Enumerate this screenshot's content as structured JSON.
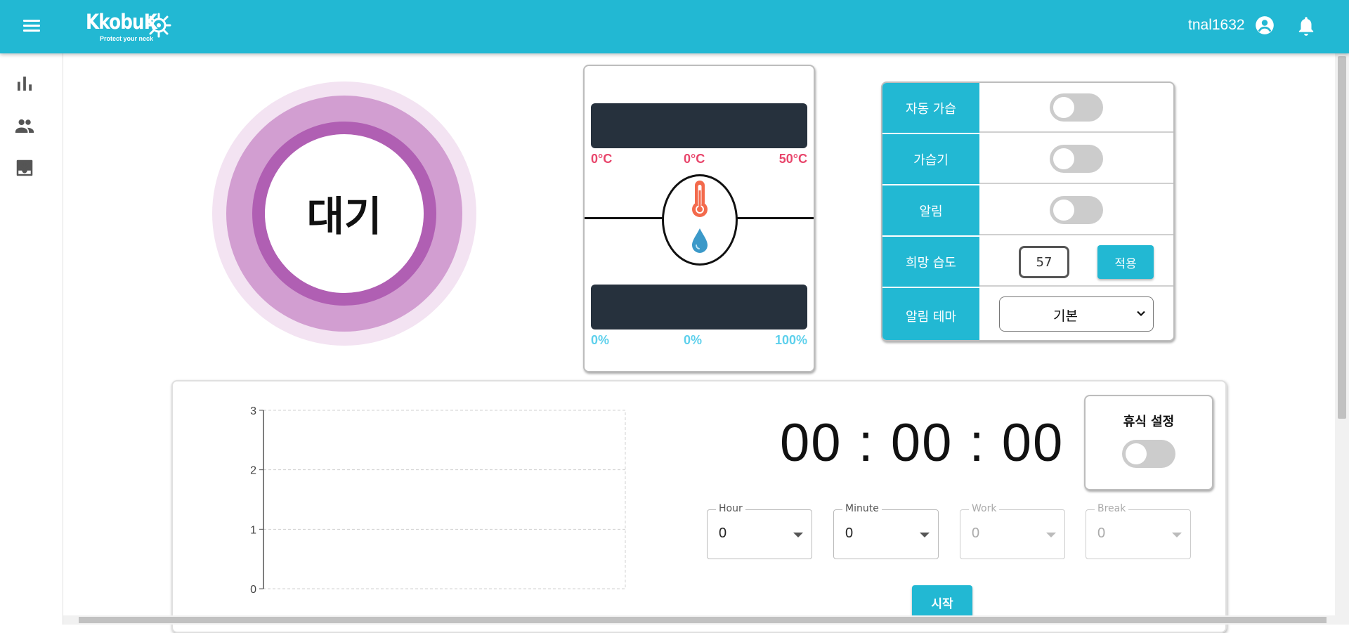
{
  "header": {
    "logo_text": "KkobuK",
    "logo_tagline": "Protect your neck",
    "username": "tnal1632",
    "icons": [
      "menu-icon",
      "account-circle-icon",
      "bell-icon"
    ]
  },
  "sidebar": {
    "items": [
      {
        "icon": "bar-chart-icon"
      },
      {
        "icon": "people-icon"
      },
      {
        "icon": "inbox-download-icon"
      }
    ]
  },
  "status": {
    "label": "대기",
    "colors": {
      "outer": "#f3e3f2",
      "middle": "#d29ed1",
      "inner": "#b05fb3"
    }
  },
  "sensor": {
    "temperature": {
      "min": "0°C",
      "current": "0°C",
      "max": "50°C",
      "color": "#e8456b"
    },
    "humidity": {
      "min": "0%",
      "current": "0%",
      "max": "100%",
      "color": "#5dd0ec"
    },
    "icons": [
      "thermometer-icon",
      "water-drop-icon"
    ]
  },
  "controls": {
    "auto_humidify": {
      "label": "자동 가습",
      "on": false
    },
    "humidifier": {
      "label": "가습기",
      "on": false
    },
    "alarm": {
      "label": "알림",
      "on": false
    },
    "desired_humidity": {
      "label": "희망 습도",
      "value": "57",
      "apply_label": "적용"
    },
    "alarm_theme": {
      "label": "알림 테마",
      "selected": "기본"
    }
  },
  "chart_data": {
    "type": "line",
    "y_ticks": [
      "0",
      "1",
      "2",
      "3"
    ],
    "ylim": [
      0,
      3
    ],
    "grid": true,
    "series": []
  },
  "timer": {
    "display": "00 : 00 : 00",
    "rest": {
      "title": "휴식 설정",
      "on": false
    },
    "fields": [
      {
        "label": "Hour",
        "value": "0",
        "disabled": false
      },
      {
        "label": "Minute",
        "value": "0",
        "disabled": false
      },
      {
        "label": "Work",
        "value": "0",
        "disabled": true
      },
      {
        "label": "Break",
        "value": "0",
        "disabled": true
      }
    ],
    "start_label": "시작"
  },
  "theme": {
    "primary": "#22b8d3",
    "dark_bar": "#26313d"
  }
}
